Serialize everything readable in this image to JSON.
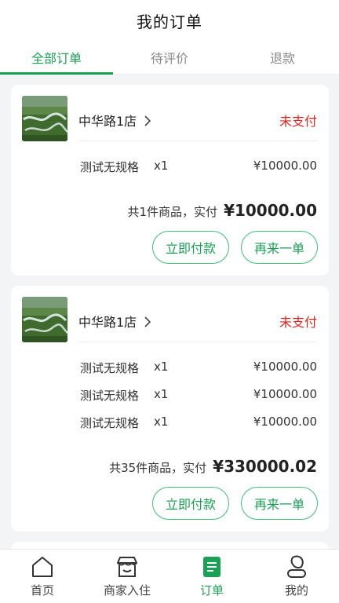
{
  "header": {
    "title": "我的订单"
  },
  "tabs": [
    {
      "label": "全部订单",
      "active": true
    },
    {
      "label": "待评价",
      "active": false
    },
    {
      "label": "退款",
      "active": false
    }
  ],
  "orders": [
    {
      "store": "中华路1店",
      "status": "未支付",
      "items": [
        {
          "name": "测试无规格",
          "qty": "x1",
          "price": "¥10000.00"
        }
      ],
      "summary_text": "共1件商品，实付",
      "amount": "¥10000.00",
      "pay_label": "立即付款",
      "reorder_label": "再来一单"
    },
    {
      "store": "中华路1店",
      "status": "未支付",
      "items": [
        {
          "name": "测试无规格",
          "qty": "x1",
          "price": "¥10000.00"
        },
        {
          "name": "测试无规格",
          "qty": "x1",
          "price": "¥10000.00"
        },
        {
          "name": "测试无规格",
          "qty": "x1",
          "price": "¥10000.00"
        }
      ],
      "summary_text": "共35件商品，实付",
      "amount": "¥330000.02",
      "pay_label": "立即付款",
      "reorder_label": "再来一单"
    }
  ],
  "bottom_nav": [
    {
      "label": "首页",
      "icon": "home-icon",
      "active": false
    },
    {
      "label": "商家入住",
      "icon": "store-icon",
      "active": false
    },
    {
      "label": "订单",
      "icon": "order-icon",
      "active": true
    },
    {
      "label": "我的",
      "icon": "user-icon",
      "active": false
    }
  ],
  "colors": {
    "accent": "#1aa156",
    "status_unpaid": "#e0251f",
    "background": "#f3f4f6"
  }
}
